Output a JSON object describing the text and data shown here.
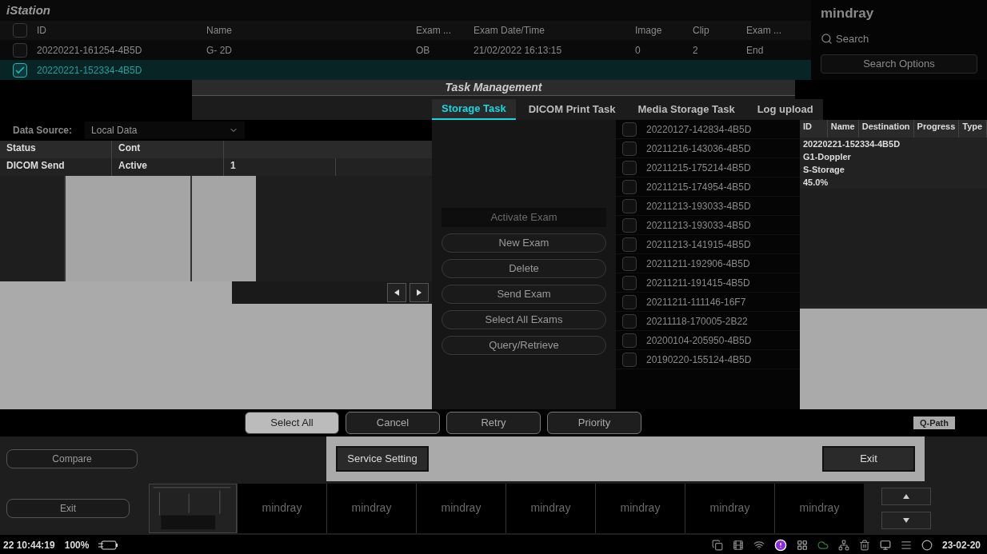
{
  "istation": {
    "title": "iStation",
    "header_checked": false,
    "columns": [
      "ID",
      "Name",
      "Exam ...",
      "Exam Date/Time",
      "Image",
      "Clip",
      "Exam ..."
    ],
    "rows": [
      {
        "checked": false,
        "selected": false,
        "cells": [
          "20220221-161254-4B5D",
          "G- 2D",
          "OB",
          "21/02/2022 16:13:15",
          "0",
          "2",
          "End"
        ]
      },
      {
        "checked": true,
        "selected": true,
        "cells": [
          "20220221-152334-4B5D"
        ]
      }
    ]
  },
  "brand": "mindray",
  "search": {
    "placeholder": "Search"
  },
  "search_options": "Search Options",
  "task_dialog": {
    "title": "Task Management",
    "tabs": [
      {
        "label": "Storage Task",
        "selected": true
      },
      {
        "label": "DICOM Print Task",
        "selected": false
      },
      {
        "label": "Media Storage Task",
        "selected": false
      },
      {
        "label": "Log upload",
        "selected": false
      }
    ],
    "data_source_label": "Data Source:",
    "data_source_value": "Local Data",
    "queue_columns": [
      "Status",
      "Cont"
    ],
    "queue_rows": [
      [
        "DICOM Send",
        "Active",
        "1"
      ]
    ],
    "task_columns": [
      "ID",
      "Name",
      "Destination",
      "Progress",
      "Type"
    ],
    "task_rows": [
      [
        "20220221-152334-4B5D",
        "G1-Doppler",
        "S-Storage",
        "45.0%"
      ]
    ],
    "buttons": [
      "Select All",
      "Cancel",
      "Retry",
      "Priority"
    ],
    "service_button": "Service Setting",
    "exit_button": "Exit"
  },
  "exam_actions": [
    {
      "label": "Activate Exam",
      "disabled": true
    },
    {
      "label": "New Exam",
      "disabled": false
    },
    {
      "label": "Delete",
      "disabled": false
    },
    {
      "label": "Send Exam",
      "disabled": false
    },
    {
      "label": "Select All Exams",
      "disabled": false
    },
    {
      "label": "Query/Retrieve",
      "disabled": false
    }
  ],
  "exam_list": [
    {
      "id": "20220127-142834-4B5D",
      "checked": false
    },
    {
      "id": "20211216-143036-4B5D",
      "checked": false
    },
    {
      "id": "20211215-175214-4B5D",
      "checked": false
    },
    {
      "id": "20211215-174954-4B5D",
      "checked": false
    },
    {
      "id": "20211213-193033-4B5D",
      "checked": false
    },
    {
      "id": "20211213-193033-4B5D",
      "checked": false
    },
    {
      "id": "20211213-141915-4B5D",
      "checked": false
    },
    {
      "id": "20211211-192906-4B5D",
      "checked": false
    },
    {
      "id": "20211211-191415-4B5D",
      "checked": false
    },
    {
      "id": "20211211-111146-16F7",
      "checked": false
    },
    {
      "id": "20211118-170005-2B22",
      "checked": false
    },
    {
      "id": "20200104-205950-4B5D",
      "checked": false
    },
    {
      "id": "20190220-155124-4B5D",
      "checked": false
    }
  ],
  "side_buttons": [
    "Compare",
    "Exit"
  ],
  "q_path": "Q-Path",
  "thumbnails": [
    {
      "kind": "image"
    },
    {
      "kind": "logo",
      "label": "mindray"
    },
    {
      "kind": "logo",
      "label": "mindray"
    },
    {
      "kind": "logo",
      "label": "mindray"
    },
    {
      "kind": "logo",
      "label": "mindray"
    },
    {
      "kind": "logo",
      "label": "mindray"
    },
    {
      "kind": "logo",
      "label": "mindray"
    },
    {
      "kind": "logo",
      "label": "mindray"
    }
  ],
  "status_bar": {
    "time": "22 10:44:19",
    "battery": "100%",
    "date": "23-02-20"
  }
}
